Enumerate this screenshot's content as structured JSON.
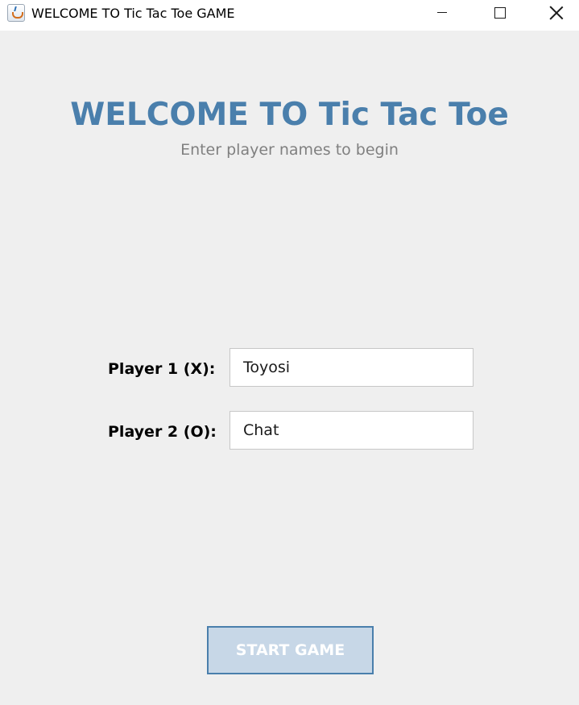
{
  "window": {
    "title": "WELCOME TO Tic Tac Toe GAME",
    "icon": "java-app-icon",
    "controls": [
      "minimize-icon",
      "maximize-icon",
      "close-icon"
    ]
  },
  "main": {
    "heading": "WELCOME TO Tic Tac Toe",
    "subheading": "Enter player names to begin",
    "player1": {
      "label": "Player 1 (X):",
      "value": "Toyosi"
    },
    "player2": {
      "label": "Player 2 (O):",
      "value": "Chat"
    },
    "start_button": "START GAME"
  },
  "colors": {
    "background": "#efefef",
    "heading": "#4a7fac",
    "subheading": "#808080",
    "button_fill": "#c7d7e7",
    "button_border": "#4a7fac"
  }
}
